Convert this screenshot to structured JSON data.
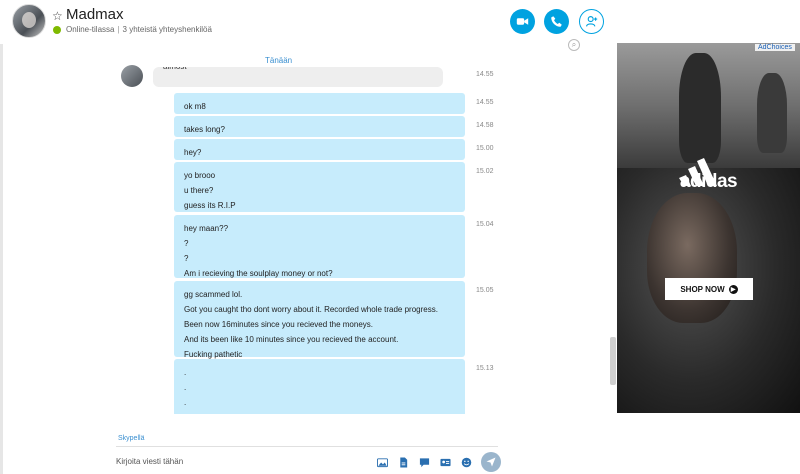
{
  "header": {
    "contact_name": "Madmax",
    "presence": "Online-tilassa",
    "mutual_contacts": "3 yhteistä yhteyshenkilöä",
    "favorite_icon": "star-icon",
    "buttons": [
      "video-call",
      "voice-call",
      "add-people"
    ]
  },
  "chat": {
    "day_separator": "Tänään",
    "incoming_partial": {
      "text": "almost",
      "time": "14.55"
    },
    "messages": [
      {
        "lines": [
          "ok m8"
        ],
        "time": "14.55"
      },
      {
        "lines": [
          "takes long?"
        ],
        "time": "14.58"
      },
      {
        "lines": [
          "hey?"
        ],
        "time": "15.00"
      },
      {
        "lines": [
          "yo brooo",
          "u there?",
          "guess its R.I.P"
        ],
        "time": "15.02"
      },
      {
        "lines": [
          "hey maan??",
          "?",
          "?",
          "Am i recieving the soulplay money or not?"
        ],
        "time": "15.04"
      },
      {
        "lines": [
          "gg scammed lol.",
          "Got you caught tho dont worry about it. Recorded whole trade progress.",
          "Been now 16minutes since you recieved the moneys.",
          "And its been like 10 minutes since you recieved the account.",
          "Fucking pathetic"
        ],
        "time": "15.05"
      },
      {
        "lines": [
          ".",
          ".",
          ".",
          "."
        ],
        "time": "15.13"
      }
    ]
  },
  "compose": {
    "network_label": "Skypellä",
    "placeholder": "Kirjoita viesti tähän"
  },
  "ad": {
    "adchoices": "AdChoices",
    "brand": "adidas",
    "cta": "SHOP NOW"
  },
  "colors": {
    "accent": "#00a2e0",
    "outgoing_bubble": "#c7ecfc",
    "incoming_bubble": "#eeeeee",
    "presence_online": "#7fba00"
  }
}
